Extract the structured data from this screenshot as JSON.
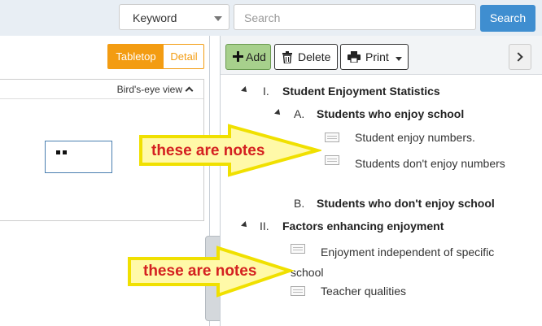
{
  "topbar": {
    "keyword_select": "Keyword",
    "search_placeholder": "Search",
    "search_button": "Search"
  },
  "left_panel": {
    "tabletop_label": "Tabletop",
    "detail_label": "Detail",
    "birds_eye_label": "Bird's-eye view"
  },
  "toolbar": {
    "add_label": "Add",
    "delete_label": "Delete",
    "print_label": "Print"
  },
  "outline": {
    "section1": {
      "num": "I.",
      "title": "Student Enjoyment Statistics"
    },
    "sub_a": {
      "num": "A.",
      "title": "Students who enjoy school"
    },
    "note_a1": "Student enjoy numbers.",
    "note_a2": "Students don't enjoy numbers",
    "sub_b": {
      "num": "B.",
      "title": "Students who don't enjoy school"
    },
    "section2": {
      "num": "II.",
      "title": "Factors enhancing enjoyment"
    },
    "note_2a": "Enjoyment independent of specific school",
    "note_2b": "Teacher qualities"
  },
  "annotations": {
    "arrow1_text": "these are notes",
    "arrow2_text": "these are notes"
  },
  "colors": {
    "search_button": "#3f8ed0",
    "tabletop_active": "#f39c12",
    "add_button": "#a7d08c",
    "arrow_fill": "#fff9a8",
    "arrow_stroke": "#f0e000",
    "annotation_text": "#d42020"
  }
}
